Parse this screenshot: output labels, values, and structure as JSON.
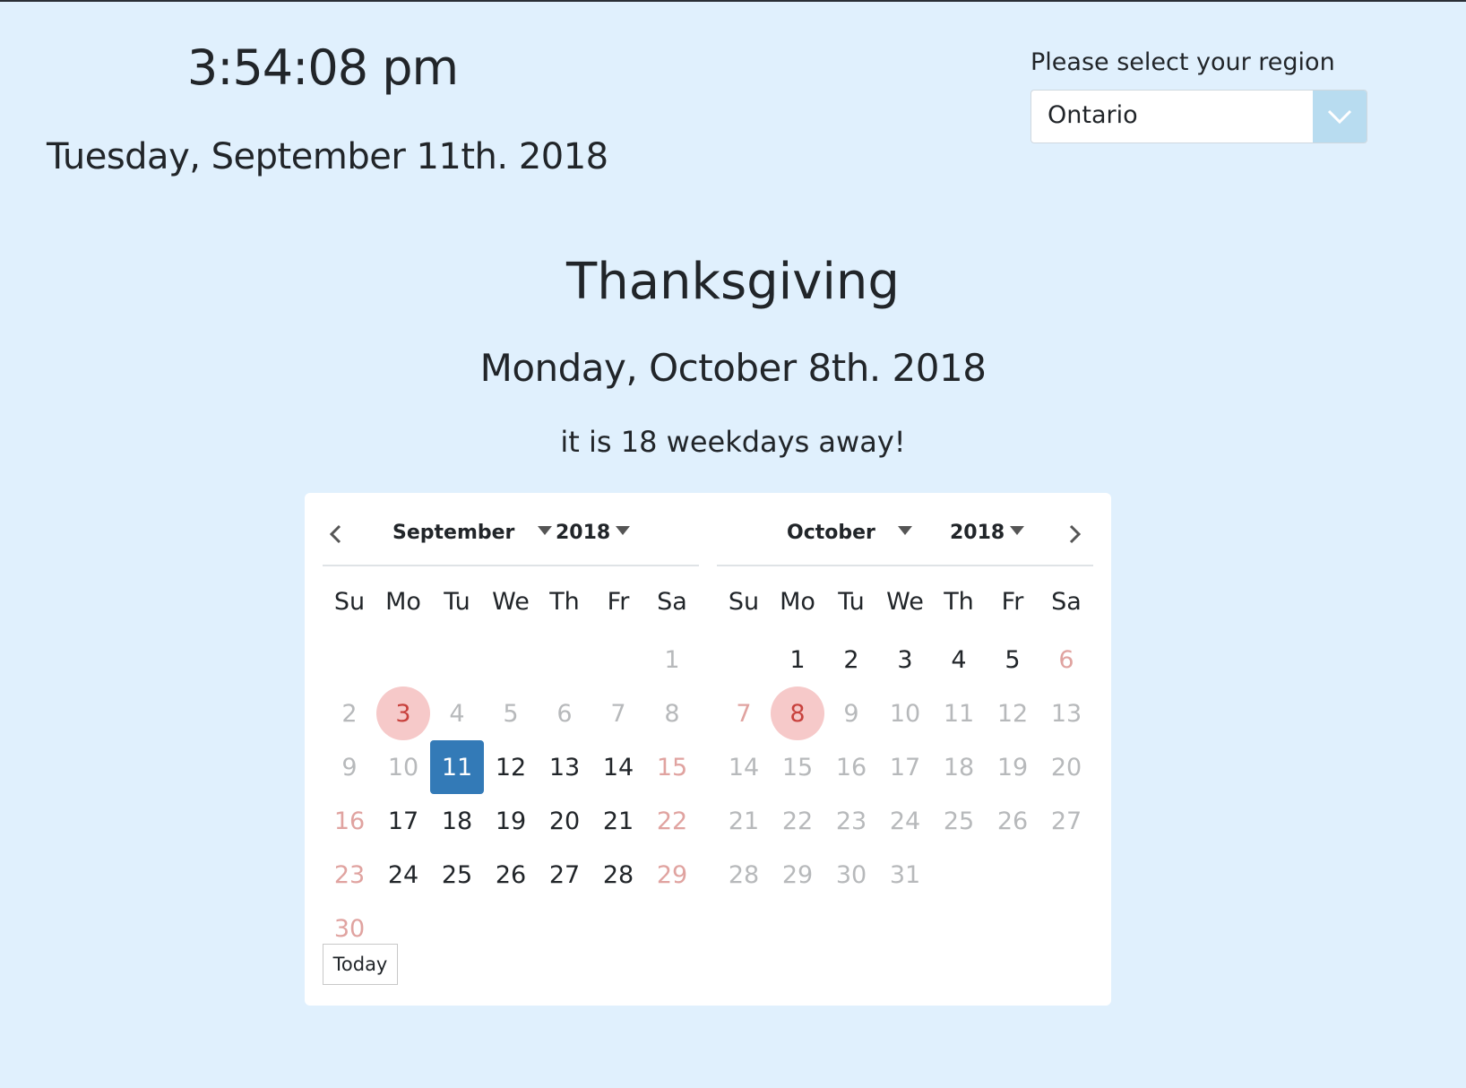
{
  "clock": {
    "time": "3:54:08 pm",
    "date": "Tuesday, September 11th. 2018"
  },
  "region": {
    "label": "Please select your region",
    "value": "Ontario"
  },
  "holiday": {
    "name": "Thanksgiving",
    "date": "Monday, October 8th. 2018",
    "countdown": "it is 18 weekdays away!"
  },
  "calendar": {
    "weekdays": [
      "Su",
      "Mo",
      "Tu",
      "We",
      "Th",
      "Fr",
      "Sa"
    ],
    "today_label": "Today",
    "months": [
      {
        "month": "September",
        "year": "2018",
        "days": [
          {
            "d": ""
          },
          {
            "d": ""
          },
          {
            "d": ""
          },
          {
            "d": ""
          },
          {
            "d": ""
          },
          {
            "d": ""
          },
          {
            "d": "1",
            "s": "dim"
          },
          {
            "d": "2",
            "s": "dim"
          },
          {
            "d": "3",
            "s": "hol"
          },
          {
            "d": "4",
            "s": "dim"
          },
          {
            "d": "5",
            "s": "dim"
          },
          {
            "d": "6",
            "s": "dim"
          },
          {
            "d": "7",
            "s": "dim"
          },
          {
            "d": "8",
            "s": "dim"
          },
          {
            "d": "9",
            "s": "dim"
          },
          {
            "d": "10",
            "s": "dim"
          },
          {
            "d": "11",
            "s": "sel"
          },
          {
            "d": "12",
            "s": "cur"
          },
          {
            "d": "13",
            "s": "cur"
          },
          {
            "d": "14",
            "s": "cur"
          },
          {
            "d": "15",
            "s": "wkend"
          },
          {
            "d": "16",
            "s": "wkend"
          },
          {
            "d": "17",
            "s": "cur"
          },
          {
            "d": "18",
            "s": "cur"
          },
          {
            "d": "19",
            "s": "cur"
          },
          {
            "d": "20",
            "s": "cur"
          },
          {
            "d": "21",
            "s": "cur"
          },
          {
            "d": "22",
            "s": "wkend"
          },
          {
            "d": "23",
            "s": "wkend"
          },
          {
            "d": "24",
            "s": "cur"
          },
          {
            "d": "25",
            "s": "cur"
          },
          {
            "d": "26",
            "s": "cur"
          },
          {
            "d": "27",
            "s": "cur"
          },
          {
            "d": "28",
            "s": "cur"
          },
          {
            "d": "29",
            "s": "wkend"
          },
          {
            "d": "30",
            "s": "wkend"
          }
        ]
      },
      {
        "month": "October",
        "year": "2018",
        "days": [
          {
            "d": ""
          },
          {
            "d": "1",
            "s": "cur"
          },
          {
            "d": "2",
            "s": "cur"
          },
          {
            "d": "3",
            "s": "cur"
          },
          {
            "d": "4",
            "s": "cur"
          },
          {
            "d": "5",
            "s": "cur"
          },
          {
            "d": "6",
            "s": "wkend"
          },
          {
            "d": "7",
            "s": "wkend"
          },
          {
            "d": "8",
            "s": "hol"
          },
          {
            "d": "9",
            "s": "dim"
          },
          {
            "d": "10",
            "s": "dim"
          },
          {
            "d": "11",
            "s": "dim"
          },
          {
            "d": "12",
            "s": "dim"
          },
          {
            "d": "13",
            "s": "dim"
          },
          {
            "d": "14",
            "s": "dim"
          },
          {
            "d": "15",
            "s": "dim"
          },
          {
            "d": "16",
            "s": "dim"
          },
          {
            "d": "17",
            "s": "dim"
          },
          {
            "d": "18",
            "s": "dim"
          },
          {
            "d": "19",
            "s": "dim"
          },
          {
            "d": "20",
            "s": "dim"
          },
          {
            "d": "21",
            "s": "dim"
          },
          {
            "d": "22",
            "s": "dim"
          },
          {
            "d": "23",
            "s": "dim"
          },
          {
            "d": "24",
            "s": "dim"
          },
          {
            "d": "25",
            "s": "dim"
          },
          {
            "d": "26",
            "s": "dim"
          },
          {
            "d": "27",
            "s": "dim"
          },
          {
            "d": "28",
            "s": "dim"
          },
          {
            "d": "29",
            "s": "dim"
          },
          {
            "d": "30",
            "s": "dim"
          },
          {
            "d": "31",
            "s": "dim"
          }
        ]
      }
    ]
  },
  "colors": {
    "background": "#e0f0fd",
    "selected": "#337ab7",
    "holiday_bg": "#f6c9c9",
    "holiday_text": "#c8413d",
    "weekend_text": "#e0a3a0",
    "muted_text": "#b7b9bb"
  },
  "icons": {
    "prev": "chevron-left-icon",
    "next": "chevron-right-icon",
    "dropdown": "chevron-down-icon",
    "caret": "caret-down-icon"
  }
}
